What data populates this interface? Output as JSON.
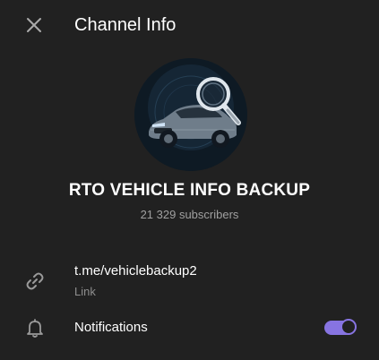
{
  "header": {
    "title": "Channel Info",
    "close_icon": "close-icon"
  },
  "profile": {
    "avatar_icon": "car-magnifier-avatar",
    "name": "RTO VEHICLE INFO BACKUP",
    "subscribers": "21 329 subscribers"
  },
  "link_row": {
    "icon": "link-icon",
    "value": "t.me/vehiclebackup2",
    "label": "Link"
  },
  "notifications_row": {
    "icon": "bell-icon",
    "label": "Notifications",
    "enabled": true
  },
  "colors": {
    "background": "#212121",
    "accent": "#8774e1",
    "secondary_text": "#a0a0a0"
  }
}
